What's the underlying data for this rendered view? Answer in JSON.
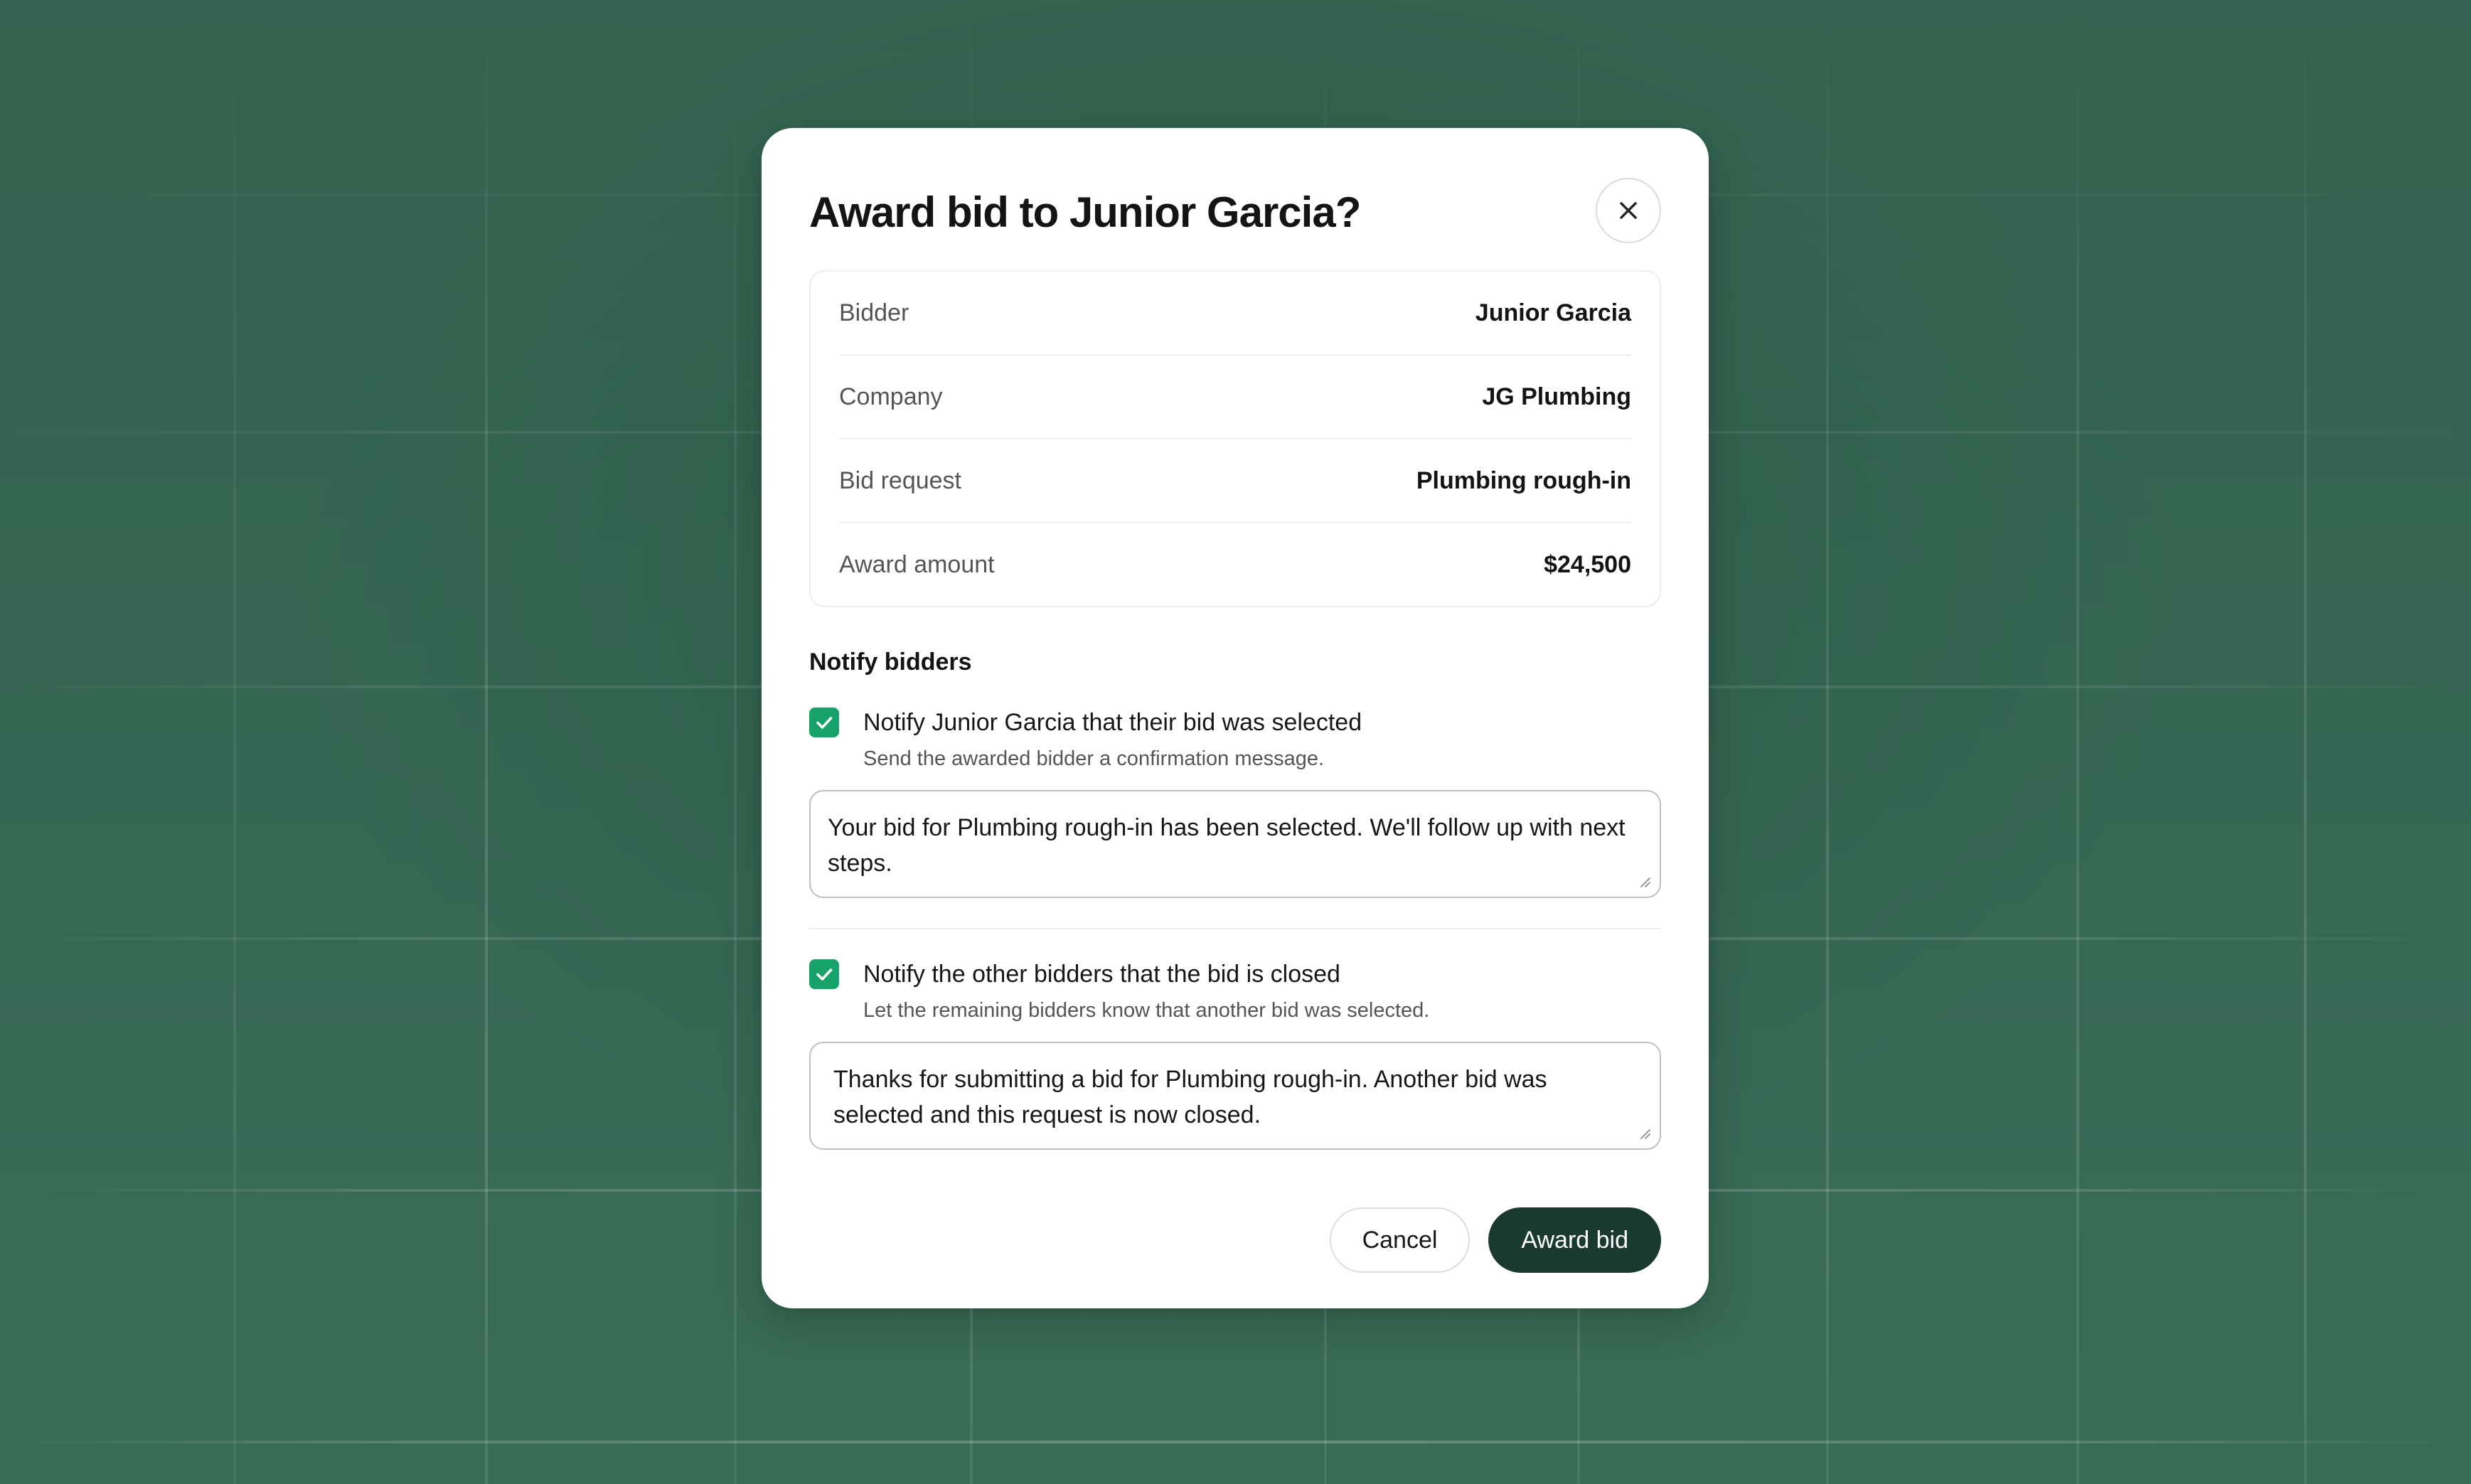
{
  "dialog": {
    "title": "Award bid to Junior Garcia?",
    "close_icon": "close-icon"
  },
  "details": [
    {
      "label": "Bidder",
      "value": "Junior Garcia"
    },
    {
      "label": "Company",
      "value": "JG Plumbing"
    },
    {
      "label": "Bid request",
      "value": "Plumbing rough-in"
    },
    {
      "label": "Award amount",
      "value": "$24,500"
    }
  ],
  "notify": {
    "heading": "Notify bidders",
    "winner": {
      "checked": true,
      "label": "Notify Junior Garcia that their bid was selected",
      "hint": "Send the awarded bidder a confirmation message.",
      "message": "Your bid for Plumbing rough-in has been selected. We'll follow up with next steps."
    },
    "others": {
      "checked": true,
      "label": "Notify the other bidders that the bid is closed",
      "hint": "Let the remaining bidders know that another bid was selected.",
      "message": "Thanks for submitting a bid for Plumbing rough-in. Another bid was selected and this request is now closed."
    }
  },
  "actions": {
    "cancel_label": "Cancel",
    "award_label": "Award bid"
  },
  "colors": {
    "backdrop": "#376754",
    "checkbox": "#17a26a",
    "primary_button": "#193a2c"
  }
}
